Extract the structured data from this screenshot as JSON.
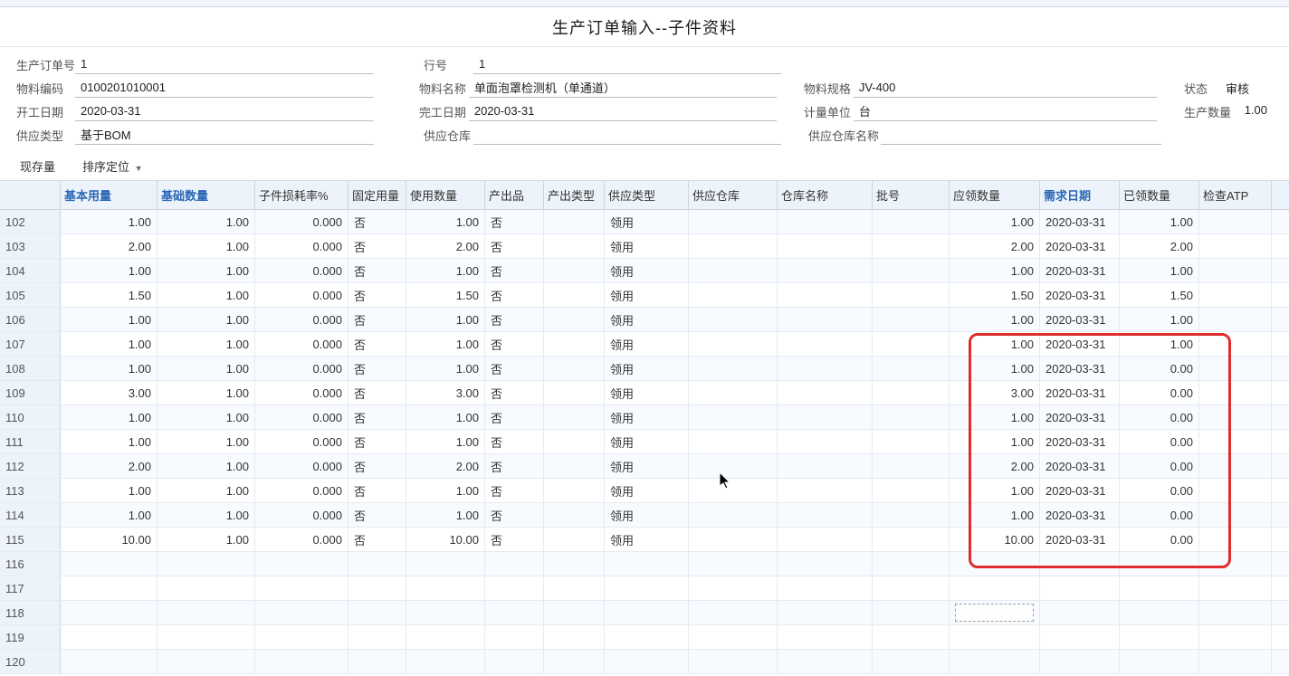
{
  "title": "生产订单输入--子件资料",
  "form": {
    "prodOrderNo": {
      "label": "生产订单号",
      "value": "1"
    },
    "lineNo": {
      "label": "行号",
      "value": "1"
    },
    "matCode": {
      "label": "物料编码",
      "value": "0100201010001"
    },
    "matName": {
      "label": "物料名称",
      "value": "单面泡罩检测机（单通道）"
    },
    "matSpec": {
      "label": "物料规格",
      "value": "JV-400"
    },
    "status": {
      "label": "状态",
      "value": "审核"
    },
    "startDate": {
      "label": "开工日期",
      "value": "2020-03-31"
    },
    "finishDate": {
      "label": "完工日期",
      "value": "2020-03-31"
    },
    "unit": {
      "label": "计量单位",
      "value": "台"
    },
    "prodQty": {
      "label": "生产数量",
      "value": "1.00"
    },
    "supplyType": {
      "label": "供应类型",
      "value": "基于BOM"
    },
    "supplyWh": {
      "label": "供应仓库",
      "value": ""
    },
    "supplyWhName": {
      "label": "供应仓库名称",
      "value": ""
    }
  },
  "tabs": {
    "stock": "现存量",
    "sort": "排序定位"
  },
  "headers": [
    "",
    "基本用量",
    "基础数量",
    "子件损耗率%",
    "固定用量",
    "使用数量",
    "产出品",
    "产出类型",
    "供应类型",
    "供应仓库",
    "仓库名称",
    "批号",
    "应领数量",
    "需求日期",
    "已领数量",
    "检查ATP"
  ],
  "rows": [
    {
      "id": "102",
      "basicQty": "1.00",
      "baseQty": "1.00",
      "lossRate": "0.000",
      "fixed": "否",
      "usedQty": "1.00",
      "outProd": "否",
      "outType": "",
      "supType": "领用",
      "supWh": "",
      "whName": "",
      "batch": "",
      "reqQty": "1.00",
      "reqDate": "2020-03-31",
      "issuedQty": "1.00",
      "atp": ""
    },
    {
      "id": "103",
      "basicQty": "2.00",
      "baseQty": "1.00",
      "lossRate": "0.000",
      "fixed": "否",
      "usedQty": "2.00",
      "outProd": "否",
      "outType": "",
      "supType": "领用",
      "supWh": "",
      "whName": "",
      "batch": "",
      "reqQty": "2.00",
      "reqDate": "2020-03-31",
      "issuedQty": "2.00",
      "atp": ""
    },
    {
      "id": "104",
      "basicQty": "1.00",
      "baseQty": "1.00",
      "lossRate": "0.000",
      "fixed": "否",
      "usedQty": "1.00",
      "outProd": "否",
      "outType": "",
      "supType": "领用",
      "supWh": "",
      "whName": "",
      "batch": "",
      "reqQty": "1.00",
      "reqDate": "2020-03-31",
      "issuedQty": "1.00",
      "atp": ""
    },
    {
      "id": "105",
      "basicQty": "1.50",
      "baseQty": "1.00",
      "lossRate": "0.000",
      "fixed": "否",
      "usedQty": "1.50",
      "outProd": "否",
      "outType": "",
      "supType": "领用",
      "supWh": "",
      "whName": "",
      "batch": "",
      "reqQty": "1.50",
      "reqDate": "2020-03-31",
      "issuedQty": "1.50",
      "atp": ""
    },
    {
      "id": "106",
      "basicQty": "1.00",
      "baseQty": "1.00",
      "lossRate": "0.000",
      "fixed": "否",
      "usedQty": "1.00",
      "outProd": "否",
      "outType": "",
      "supType": "领用",
      "supWh": "",
      "whName": "",
      "batch": "",
      "reqQty": "1.00",
      "reqDate": "2020-03-31",
      "issuedQty": "1.00",
      "atp": ""
    },
    {
      "id": "107",
      "basicQty": "1.00",
      "baseQty": "1.00",
      "lossRate": "0.000",
      "fixed": "否",
      "usedQty": "1.00",
      "outProd": "否",
      "outType": "",
      "supType": "领用",
      "supWh": "",
      "whName": "",
      "batch": "",
      "reqQty": "1.00",
      "reqDate": "2020-03-31",
      "issuedQty": "1.00",
      "atp": ""
    },
    {
      "id": "108",
      "basicQty": "1.00",
      "baseQty": "1.00",
      "lossRate": "0.000",
      "fixed": "否",
      "usedQty": "1.00",
      "outProd": "否",
      "outType": "",
      "supType": "领用",
      "supWh": "",
      "whName": "",
      "batch": "",
      "reqQty": "1.00",
      "reqDate": "2020-03-31",
      "issuedQty": "0.00",
      "atp": ""
    },
    {
      "id": "109",
      "basicQty": "3.00",
      "baseQty": "1.00",
      "lossRate": "0.000",
      "fixed": "否",
      "usedQty": "3.00",
      "outProd": "否",
      "outType": "",
      "supType": "领用",
      "supWh": "",
      "whName": "",
      "batch": "",
      "reqQty": "3.00",
      "reqDate": "2020-03-31",
      "issuedQty": "0.00",
      "atp": ""
    },
    {
      "id": "110",
      "basicQty": "1.00",
      "baseQty": "1.00",
      "lossRate": "0.000",
      "fixed": "否",
      "usedQty": "1.00",
      "outProd": "否",
      "outType": "",
      "supType": "领用",
      "supWh": "",
      "whName": "",
      "batch": "",
      "reqQty": "1.00",
      "reqDate": "2020-03-31",
      "issuedQty": "0.00",
      "atp": ""
    },
    {
      "id": "111",
      "basicQty": "1.00",
      "baseQty": "1.00",
      "lossRate": "0.000",
      "fixed": "否",
      "usedQty": "1.00",
      "outProd": "否",
      "outType": "",
      "supType": "领用",
      "supWh": "",
      "whName": "",
      "batch": "",
      "reqQty": "1.00",
      "reqDate": "2020-03-31",
      "issuedQty": "0.00",
      "atp": ""
    },
    {
      "id": "112",
      "basicQty": "2.00",
      "baseQty": "1.00",
      "lossRate": "0.000",
      "fixed": "否",
      "usedQty": "2.00",
      "outProd": "否",
      "outType": "",
      "supType": "领用",
      "supWh": "",
      "whName": "",
      "batch": "",
      "reqQty": "2.00",
      "reqDate": "2020-03-31",
      "issuedQty": "0.00",
      "atp": ""
    },
    {
      "id": "113",
      "basicQty": "1.00",
      "baseQty": "1.00",
      "lossRate": "0.000",
      "fixed": "否",
      "usedQty": "1.00",
      "outProd": "否",
      "outType": "",
      "supType": "领用",
      "supWh": "",
      "whName": "",
      "batch": "",
      "reqQty": "1.00",
      "reqDate": "2020-03-31",
      "issuedQty": "0.00",
      "atp": ""
    },
    {
      "id": "114",
      "basicQty": "1.00",
      "baseQty": "1.00",
      "lossRate": "0.000",
      "fixed": "否",
      "usedQty": "1.00",
      "outProd": "否",
      "outType": "",
      "supType": "领用",
      "supWh": "",
      "whName": "",
      "batch": "",
      "reqQty": "1.00",
      "reqDate": "2020-03-31",
      "issuedQty": "0.00",
      "atp": ""
    },
    {
      "id": "115",
      "basicQty": "10.00",
      "baseQty": "1.00",
      "lossRate": "0.000",
      "fixed": "否",
      "usedQty": "10.00",
      "outProd": "否",
      "outType": "",
      "supType": "领用",
      "supWh": "",
      "whName": "",
      "batch": "",
      "reqQty": "10.00",
      "reqDate": "2020-03-31",
      "issuedQty": "0.00",
      "atp": ""
    },
    {
      "id": "116",
      "basicQty": "",
      "baseQty": "",
      "lossRate": "",
      "fixed": "",
      "usedQty": "",
      "outProd": "",
      "outType": "",
      "supType": "",
      "supWh": "",
      "whName": "",
      "batch": "",
      "reqQty": "",
      "reqDate": "",
      "issuedQty": "",
      "atp": ""
    },
    {
      "id": "117",
      "basicQty": "",
      "baseQty": "",
      "lossRate": "",
      "fixed": "",
      "usedQty": "",
      "outProd": "",
      "outType": "",
      "supType": "",
      "supWh": "",
      "whName": "",
      "batch": "",
      "reqQty": "",
      "reqDate": "",
      "issuedQty": "",
      "atp": ""
    },
    {
      "id": "118",
      "basicQty": "",
      "baseQty": "",
      "lossRate": "",
      "fixed": "",
      "usedQty": "",
      "outProd": "",
      "outType": "",
      "supType": "",
      "supWh": "",
      "whName": "",
      "batch": "",
      "reqQty": "",
      "reqDate": "",
      "issuedQty": "",
      "atp": ""
    },
    {
      "id": "119",
      "basicQty": "",
      "baseQty": "",
      "lossRate": "",
      "fixed": "",
      "usedQty": "",
      "outProd": "",
      "outType": "",
      "supType": "",
      "supWh": "",
      "whName": "",
      "batch": "",
      "reqQty": "",
      "reqDate": "",
      "issuedQty": "",
      "atp": ""
    },
    {
      "id": "120",
      "basicQty": "",
      "baseQty": "",
      "lossRate": "",
      "fixed": "",
      "usedQty": "",
      "outProd": "",
      "outType": "",
      "supType": "",
      "supWh": "",
      "whName": "",
      "batch": "",
      "reqQty": "",
      "reqDate": "",
      "issuedQty": "",
      "atp": ""
    }
  ]
}
